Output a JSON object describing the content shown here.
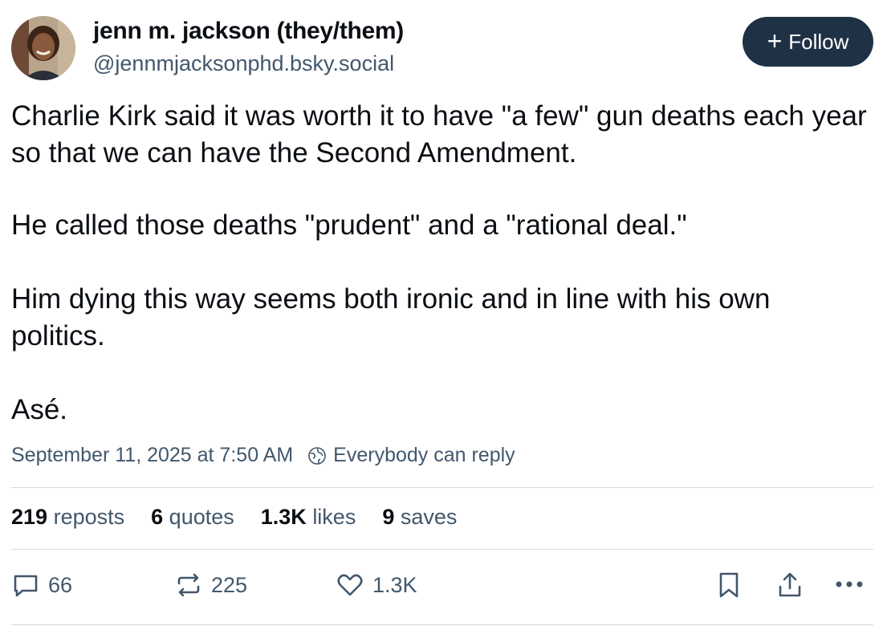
{
  "author": {
    "display_name": "jenn m. jackson (they/them)",
    "handle": "@jennmjacksonphd.bsky.social"
  },
  "follow_button": {
    "icon": "plus-icon",
    "label": "Follow"
  },
  "post": {
    "paragraphs": [
      "Charlie Kirk said it was worth it to have \"a few\" gun deaths each year so that we can have the Second Amendment.",
      "He called those deaths \"prudent\" and a \"rational deal.\"",
      "Him dying this way seems both ironic and in line with his own politics.",
      "Asé."
    ],
    "timestamp": "September 11, 2025 at 7:50 AM",
    "reply_setting": "Everybody can reply"
  },
  "stats": {
    "reposts": {
      "count": "219",
      "label": "reposts"
    },
    "quotes": {
      "count": "6",
      "label": "quotes"
    },
    "likes": {
      "count": "1.3K",
      "label": "likes"
    },
    "saves": {
      "count": "9",
      "label": "saves"
    }
  },
  "actions": {
    "reply": {
      "icon": "reply-bubble-icon",
      "count": "66"
    },
    "repost": {
      "icon": "repost-icon",
      "count": "225"
    },
    "like": {
      "icon": "heart-icon",
      "count": "1.3K"
    },
    "bookmark": {
      "icon": "bookmark-icon"
    },
    "share": {
      "icon": "share-icon"
    },
    "more": {
      "icon": "more-dots-icon"
    }
  },
  "colors": {
    "primary_text": "#0b0f14",
    "secondary_text": "#42576c",
    "follow_button_bg": "#1f3145",
    "divider": "#d4dbe2"
  }
}
